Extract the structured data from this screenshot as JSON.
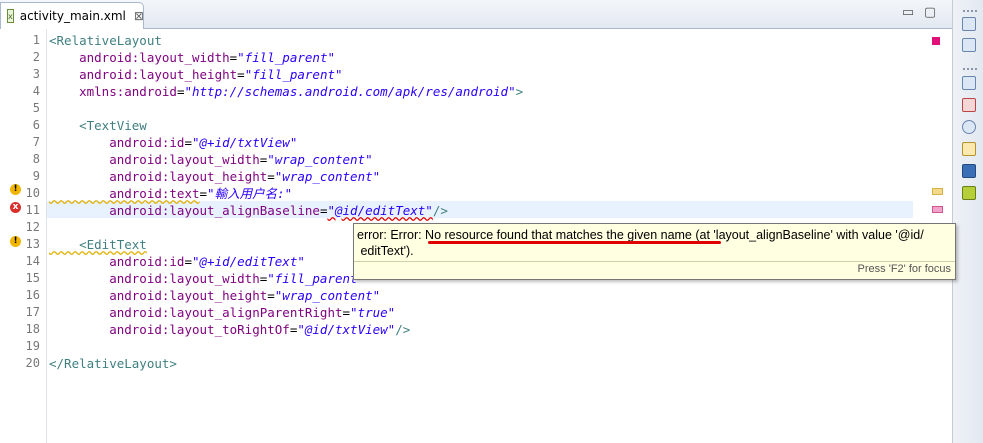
{
  "tab": {
    "title": "activity_main.xml",
    "close": "⊠"
  },
  "window": {
    "minimize": "▭",
    "maximize": "▢"
  },
  "lines": [
    {
      "n": "1",
      "parts": [
        {
          "t": "<RelativeLayout",
          "c": "tag"
        }
      ]
    },
    {
      "n": "2",
      "parts": [
        {
          "t": "    android:layout_width",
          "c": "attr"
        },
        {
          "t": "=",
          "c": "eq"
        },
        {
          "t": "\"fill_parent\"",
          "c": "val"
        }
      ]
    },
    {
      "n": "3",
      "parts": [
        {
          "t": "    android:layout_height",
          "c": "attr"
        },
        {
          "t": "=",
          "c": "eq"
        },
        {
          "t": "\"fill_parent\"",
          "c": "val"
        }
      ]
    },
    {
      "n": "4",
      "parts": [
        {
          "t": "    xmlns:android",
          "c": "attr"
        },
        {
          "t": "=",
          "c": "eq"
        },
        {
          "t": "\"http://schemas.android.com/apk/res/android\"",
          "c": "val"
        },
        {
          "t": ">",
          "c": "tag"
        }
      ]
    },
    {
      "n": "5",
      "parts": []
    },
    {
      "n": "6",
      "parts": [
        {
          "t": "    <TextView",
          "c": "tag"
        }
      ]
    },
    {
      "n": "7",
      "parts": [
        {
          "t": "        android:id",
          "c": "attr"
        },
        {
          "t": "=",
          "c": "eq"
        },
        {
          "t": "\"@+id/txtView\"",
          "c": "val"
        }
      ]
    },
    {
      "n": "8",
      "parts": [
        {
          "t": "        android:layout_width",
          "c": "attr"
        },
        {
          "t": "=",
          "c": "eq"
        },
        {
          "t": "\"wrap_content\"",
          "c": "val"
        }
      ]
    },
    {
      "n": "9",
      "parts": [
        {
          "t": "        android:layout_height",
          "c": "attr"
        },
        {
          "t": "=",
          "c": "eq"
        },
        {
          "t": "\"wrap_content\"",
          "c": "val"
        }
      ]
    },
    {
      "n": "10",
      "parts": [
        {
          "t": "        android:text",
          "c": "attr warn-underline"
        },
        {
          "t": "=",
          "c": "eq"
        },
        {
          "t": "\"輸入用户名:\"",
          "c": "val"
        }
      ]
    },
    {
      "n": "11",
      "parts": [
        {
          "t": "        android:layout_alignBaseline",
          "c": "attr"
        },
        {
          "t": "=",
          "c": "eq"
        },
        {
          "t": "\"@id/editText\"",
          "c": "val err-underline"
        },
        {
          "t": "/>",
          "c": "tag"
        }
      ]
    },
    {
      "n": "12",
      "parts": []
    },
    {
      "n": "13",
      "parts": [
        {
          "t": "    <EditText",
          "c": "tag warn-underline"
        }
      ]
    },
    {
      "n": "14",
      "parts": [
        {
          "t": "        android:id",
          "c": "attr"
        },
        {
          "t": "=",
          "c": "eq"
        },
        {
          "t": "\"@+id/editText\"",
          "c": "val"
        }
      ]
    },
    {
      "n": "15",
      "parts": [
        {
          "t": "        android:layout_width",
          "c": "attr"
        },
        {
          "t": "=",
          "c": "eq"
        },
        {
          "t": "\"fill_parent\"",
          "c": "val"
        }
      ]
    },
    {
      "n": "16",
      "parts": [
        {
          "t": "        android:layout_height",
          "c": "attr"
        },
        {
          "t": "=",
          "c": "eq"
        },
        {
          "t": "\"wrap_content\"",
          "c": "val"
        }
      ]
    },
    {
      "n": "17",
      "parts": [
        {
          "t": "        android:layout_alignParentRight",
          "c": "attr"
        },
        {
          "t": "=",
          "c": "eq"
        },
        {
          "t": "\"true\"",
          "c": "val"
        }
      ]
    },
    {
      "n": "18",
      "parts": [
        {
          "t": "        android:layout_toRightOf",
          "c": "attr"
        },
        {
          "t": "=",
          "c": "eq"
        },
        {
          "t": "\"@id/txtView\"",
          "c": "val"
        },
        {
          "t": "/>",
          "c": "tag"
        }
      ]
    },
    {
      "n": "19",
      "parts": []
    },
    {
      "n": "20",
      "parts": [
        {
          "t": "</RelativeLayout>",
          "c": "tag"
        }
      ]
    }
  ],
  "gutter": {
    "warning_icon": "warning-icon",
    "error_icon": "error-icon",
    "warning_glyph": "!",
    "error_glyph": "x"
  },
  "tooltip": {
    "message": "error: Error: No resource found that matches the given name (at 'layout_alignBaseline' with value '@id/\n editText').",
    "footer": "Press 'F2' for focus"
  },
  "colors": {
    "tag": "#3f7f7f",
    "attr": "#7f007f",
    "value": "#2a00ff",
    "error": "#e00000",
    "warning": "#e0b000",
    "current_line": "#e8f2fe"
  }
}
